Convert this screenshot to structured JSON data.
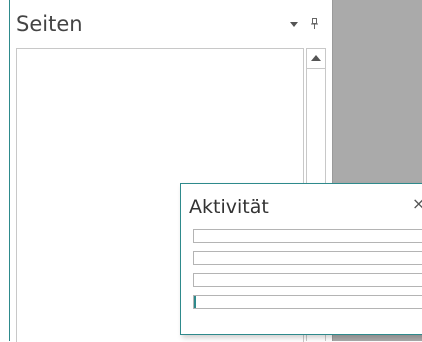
{
  "pages_pane": {
    "title": "Seiten",
    "menu_icon": "chevron-down-icon",
    "pin_icon": "pin-icon"
  },
  "activity_window": {
    "title": "Aktivität",
    "close_glyph": "×",
    "progress_bars": [
      {
        "fraction": 0
      },
      {
        "fraction": 0
      },
      {
        "fraction": 0
      },
      {
        "fraction": 0.008
      }
    ]
  },
  "colors": {
    "accent": "#2e8a8c",
    "workspace": "#aaaaaa"
  }
}
